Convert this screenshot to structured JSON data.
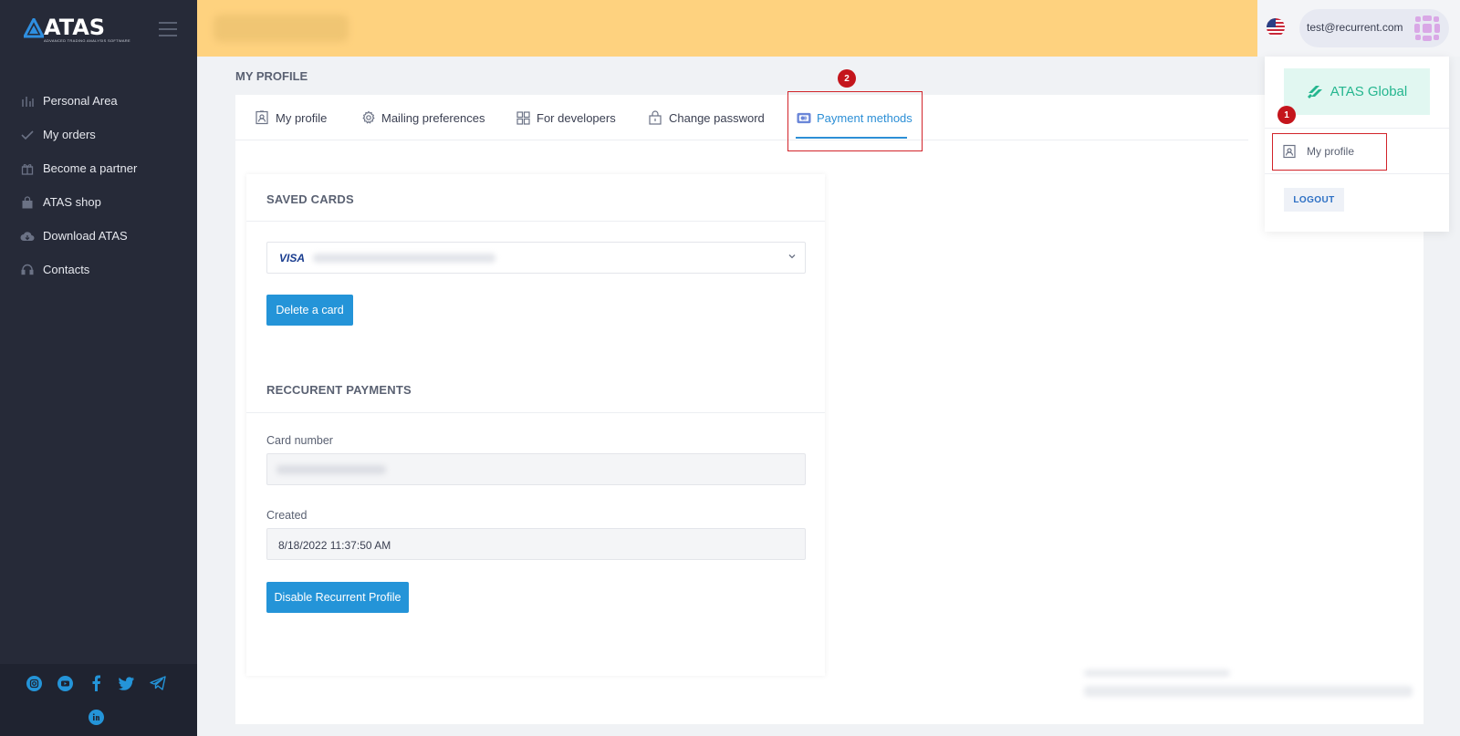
{
  "app": {
    "name": "ATAS",
    "tagline": "ADVANCED TRADING ANALYSIS SOFTWARE"
  },
  "sidebar": {
    "items": [
      {
        "label": "Personal Area",
        "icon": "bar-chart-icon"
      },
      {
        "label": "My orders",
        "icon": "check-icon"
      },
      {
        "label": "Become a partner",
        "icon": "gift-icon"
      },
      {
        "label": "ATAS shop",
        "icon": "shopping-bag-icon"
      },
      {
        "label": "Download ATAS",
        "icon": "cloud-download-icon"
      },
      {
        "label": "Contacts",
        "icon": "headset-icon"
      }
    ],
    "social": [
      "instagram-icon",
      "youtube-icon",
      "facebook-icon",
      "twitter-icon",
      "telegram-icon",
      "linkedin-icon"
    ]
  },
  "header": {
    "user_email": "test@recurrent.com",
    "flag": "us-flag-icon"
  },
  "page": {
    "title": "MY PROFILE"
  },
  "tabs": [
    {
      "label": "My profile",
      "icon": "id-card-icon"
    },
    {
      "label": "Mailing preferences",
      "icon": "gear-icon"
    },
    {
      "label": "For developers",
      "icon": "grid-icon"
    },
    {
      "label": "Change password",
      "icon": "lock-icon"
    },
    {
      "label": "Payment methods",
      "icon": "credit-card-icon",
      "active": true
    }
  ],
  "saved_cards": {
    "title": "SAVED CARDS",
    "card_brand": "VISA",
    "delete_label": "Delete a card"
  },
  "recurrent": {
    "title": "RECCURENT PAYMENTS",
    "card_number_label": "Card number",
    "created_label": "Created",
    "created_value": "8/18/2022 11:37:50 AM",
    "disable_label": "Disable Recurrent Profile"
  },
  "dropdown": {
    "atas_global": "ATAS Global",
    "my_profile": "My profile",
    "logout": "LOGOUT"
  },
  "annotations": {
    "badge1": "1",
    "badge2": "2"
  },
  "colors": {
    "sidebar": "#262a38",
    "header": "#fed27f",
    "accent": "#2494d8",
    "annotation": "#d2242a",
    "brand_green": "#25b68f"
  }
}
